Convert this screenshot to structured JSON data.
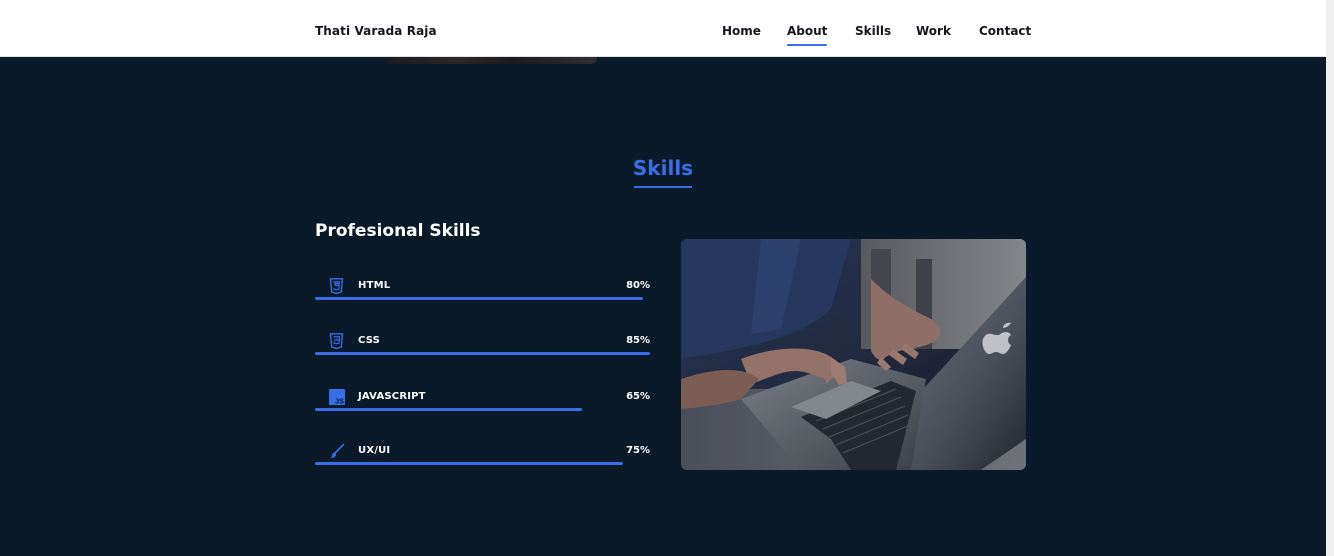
{
  "header": {
    "logo": "Thati Varada Raja",
    "nav": [
      {
        "label": "Home",
        "active": false
      },
      {
        "label": "About",
        "active": true
      },
      {
        "label": "Skills",
        "active": false
      },
      {
        "label": "Work",
        "active": false
      },
      {
        "label": "Contact",
        "active": false
      }
    ]
  },
  "skills_section": {
    "title": "Skills",
    "subtitle": "Profesional Skills",
    "skills": [
      {
        "name": "HTML",
        "percent_label": "80%",
        "level": 80,
        "icon": "html5-icon"
      },
      {
        "name": "CSS",
        "percent_label": "85%",
        "level": 85,
        "icon": "css3-icon"
      },
      {
        "name": "JAVASCRIPT",
        "percent_label": "65%",
        "level": 65,
        "icon": "javascript-icon"
      },
      {
        "name": "UX/UI",
        "percent_label": "75%",
        "level": 75,
        "icon": "pen-brush-icon"
      }
    ]
  },
  "colors": {
    "accent": "#3a6ee9",
    "background": "#0a1a29",
    "header_bg": "#ffffff",
    "text_light": "#ffffff",
    "text_dark": "#14171c"
  }
}
